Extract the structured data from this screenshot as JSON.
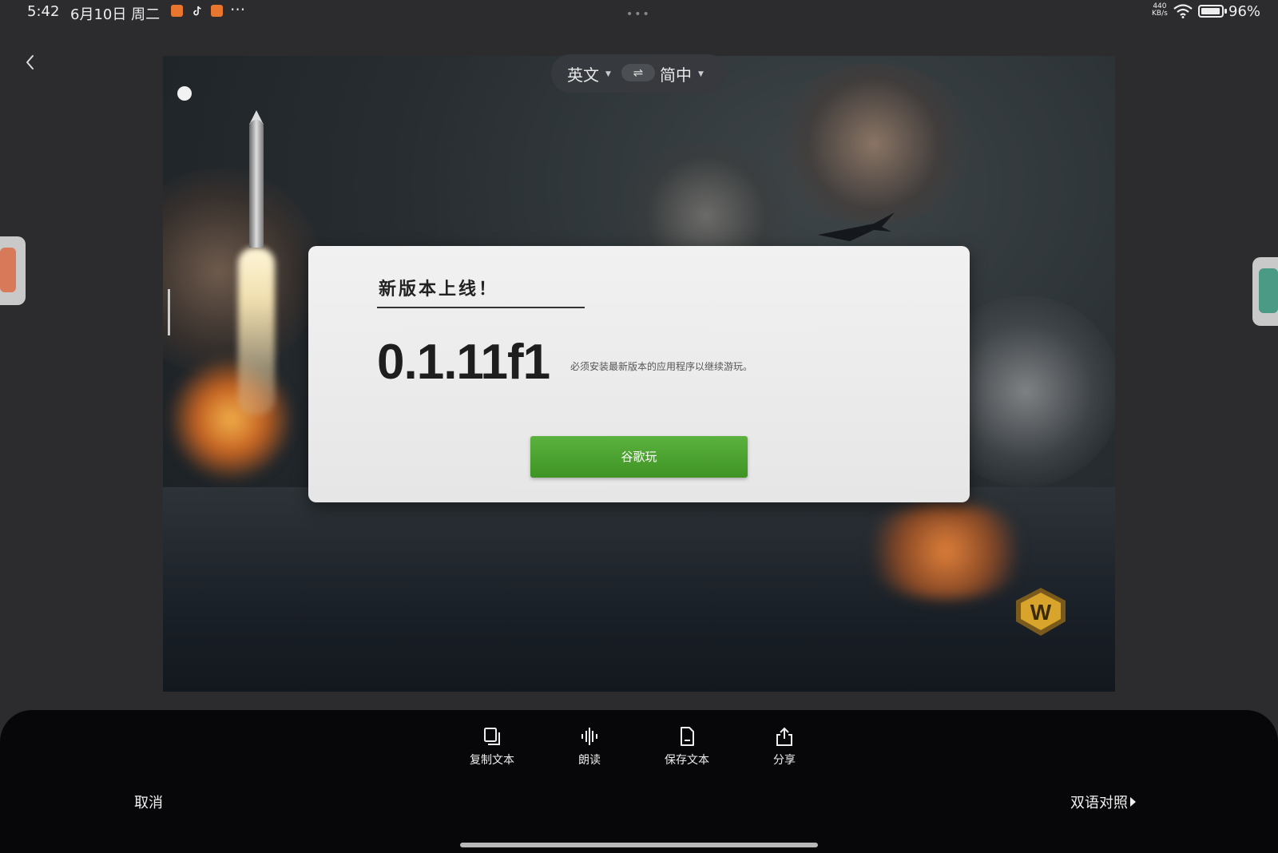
{
  "status_bar": {
    "time": "5:42",
    "date": "6月10日 周二",
    "more": "···",
    "center_dots": "•••",
    "net_speed_value": "440",
    "net_speed_unit": "KB/s",
    "battery": "96%",
    "battery_level": 0.96
  },
  "translate_bar": {
    "source_lang": "英文",
    "swap_icon": "⇌",
    "target_lang": "简中"
  },
  "dialog": {
    "title": "新版本上线！",
    "version": "0.1.11f1",
    "description": "必须安装最新版本的应用程序以继续游玩。",
    "button_label": "谷歌玩"
  },
  "logo": {
    "letter": "W",
    "color": "#d9a42b"
  },
  "toolbar": {
    "items": [
      {
        "label": "复制文本",
        "icon": "copy-icon"
      },
      {
        "label": "朗读",
        "icon": "read-aloud-icon"
      },
      {
        "label": "保存文本",
        "icon": "save-file-icon"
      },
      {
        "label": "分享",
        "icon": "share-icon"
      }
    ],
    "cancel_label": "取消",
    "bilingual_label": "双语对照"
  },
  "colors": {
    "background": "#2c2c2f",
    "panel": "#070709",
    "button_green": "#4ea32f"
  }
}
